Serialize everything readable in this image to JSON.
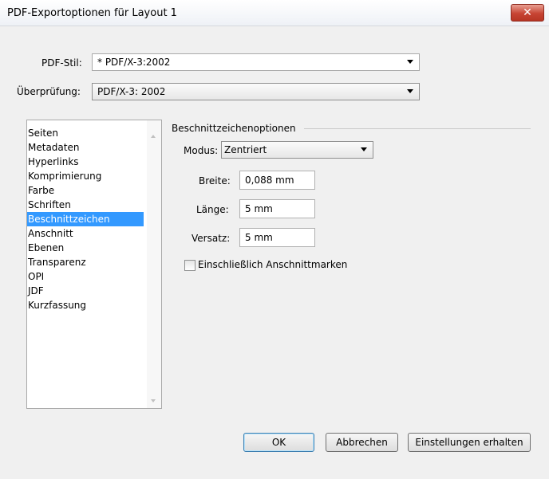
{
  "window": {
    "title": "PDF-Exportoptionen für Layout 1",
    "close_glyph": "✕"
  },
  "top": {
    "style_label": "PDF-Stil:",
    "style_value": "* PDF/X-3:2002",
    "check_label": "Überprüfung:",
    "check_value": "PDF/X-3: 2002"
  },
  "sidebar": {
    "items": [
      {
        "label": "Seiten"
      },
      {
        "label": "Metadaten"
      },
      {
        "label": "Hyperlinks"
      },
      {
        "label": "Komprimierung"
      },
      {
        "label": "Farbe"
      },
      {
        "label": "Schriften"
      },
      {
        "label": "Beschnittzeichen",
        "selected": true
      },
      {
        "label": "Anschnitt"
      },
      {
        "label": "Ebenen"
      },
      {
        "label": "Transparenz"
      },
      {
        "label": "OPI"
      },
      {
        "label": "JDF"
      },
      {
        "label": "Kurzfassung"
      }
    ]
  },
  "panel": {
    "group_title": "Beschnittzeichenoptionen",
    "mode_label": "Modus:",
    "mode_value": "Zentriert",
    "width_label": "Breite:",
    "width_value": "0,088 mm",
    "length_label": "Länge:",
    "length_value": "5 mm",
    "offset_label": "Versatz:",
    "offset_value": "5 mm",
    "include_bleed_label": "Einschließlich Anschnittmarken",
    "include_bleed_checked": false
  },
  "buttons": {
    "ok": "OK",
    "cancel": "Abbrechen",
    "keep_settings": "Einstellungen erhalten"
  }
}
